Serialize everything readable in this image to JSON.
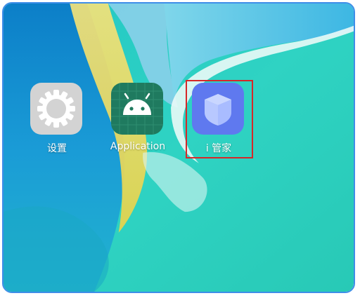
{
  "screen": {
    "kind": "home-screen",
    "frame_color": "#3f8ee8",
    "highlight_color": "#d62828"
  },
  "apps": [
    {
      "label": "设置",
      "icon": "settings-gear-icon",
      "icon_bg": "#cfcfcf"
    },
    {
      "label": "Application",
      "icon": "android-icon",
      "icon_bg": "#1f7a5f"
    },
    {
      "label": "i 管家",
      "icon": "shield-cube-icon",
      "icon_bg": "#5f79ef"
    }
  ]
}
